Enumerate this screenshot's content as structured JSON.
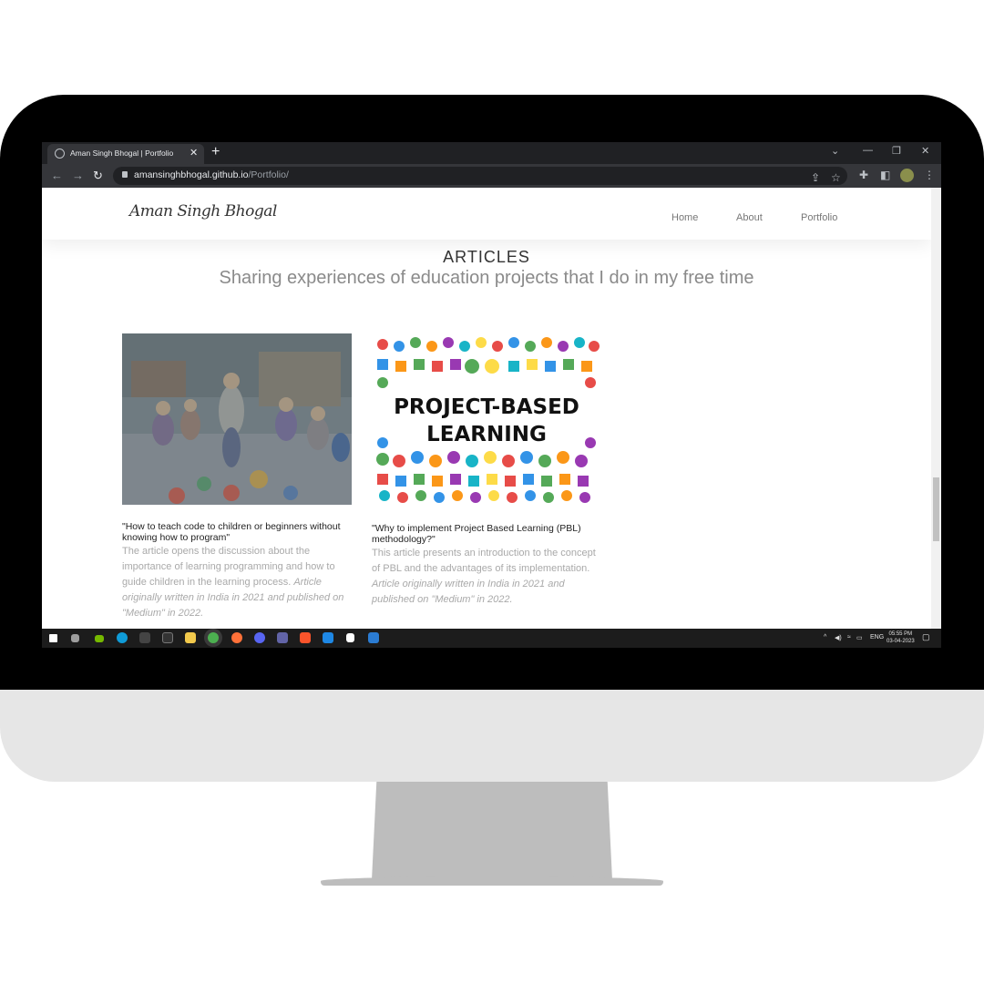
{
  "browser": {
    "tab_title": "Aman Singh Bhogal | Portfolio",
    "tab_close": "✕",
    "new_tab": "+",
    "url_host": "amansinghbhogal.github.io",
    "url_path": "/Portfolio/"
  },
  "site": {
    "logo": "Aman Singh Bhogal",
    "nav": [
      "Home",
      "About",
      "Portfolio"
    ]
  },
  "section": {
    "title": "ARTICLES",
    "subtitle": "Sharing experiences of education projects that I do in my free time"
  },
  "articles": [
    {
      "title": "\"How to teach code to children or beginners without knowing how to program\"",
      "desc": "The article opens the discussion about the importance of learning programming and how to guide children in the learning process. ",
      "desc_italic": "Article originally written in India in 2021 and published on \"Medium\" in 2022.",
      "image_label": "children-classroom-photo"
    },
    {
      "title": "\"Why to implement Project Based Learning (PBL) methodology?\"",
      "desc": "This article presents an introduction to the concept of PBL and the advantages of its implementation. ",
      "desc_italic": "Article originally written in India in 2021 and published on \"Medium\" in 2022.",
      "image_text_line1": "PROJECT-BASED",
      "image_text_line2": "LEARNING"
    }
  ],
  "taskbar": {
    "lang": "ENG",
    "time": "05:55 PM",
    "date": "03-04-2023"
  },
  "colors": {
    "chrome_dark": "#202124",
    "chrome_mid": "#35363a",
    "muted_text": "#a9a9a9"
  }
}
